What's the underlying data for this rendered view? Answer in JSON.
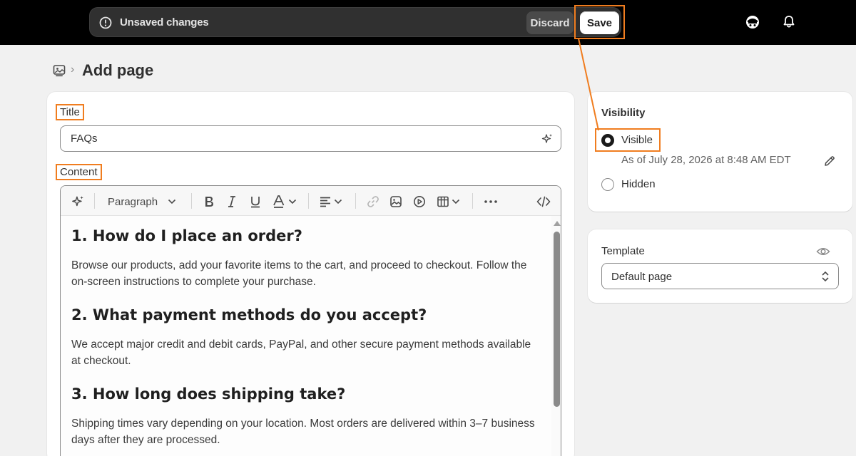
{
  "topbar": {
    "unsaved_text": "Unsaved changes",
    "discard_label": "Discard",
    "save_label": "Save",
    "icons": [
      "alert-circle-icon",
      "store-avatar-icon",
      "bell-icon"
    ]
  },
  "breadcrumb": {
    "icon": "page-icon",
    "separator": "›",
    "title": "Add page"
  },
  "form": {
    "title_label": "Title",
    "title_value": "FAQs",
    "content_label": "Content"
  },
  "toolbar": {
    "paragraph_label": "Paragraph",
    "items": [
      "magic-icon",
      "paragraph-select",
      "bold-icon",
      "italic-icon",
      "underline-icon",
      "text-color-icon",
      "align-icon",
      "link-icon",
      "image-icon",
      "video-icon",
      "table-icon",
      "more-icon",
      "code-icon"
    ]
  },
  "content": {
    "q1": "1. How do I place an order?",
    "a1": "Browse our products, add your favorite items to the cart, and proceed to checkout. Follow the on-screen instructions to complete your purchase.",
    "q2": "2. What payment methods do you accept?",
    "a2": "We accept major credit and debit cards, PayPal, and other secure payment methods available at checkout.",
    "q3": "3. How long does shipping take?",
    "a3": "Shipping times vary depending on your location. Most orders are delivered within 3–7 business days after they are processed."
  },
  "visibility": {
    "heading": "Visibility",
    "visible_label": "Visible",
    "visible_note": "As of July 28, 2026 at 8:48 AM EDT",
    "hidden_label": "Hidden",
    "selected": "Visible"
  },
  "template": {
    "heading": "Template",
    "selected": "Default page"
  },
  "colors": {
    "topbar": "#000000",
    "highlight": "#f07d1f",
    "background": "#f1f1f1"
  }
}
